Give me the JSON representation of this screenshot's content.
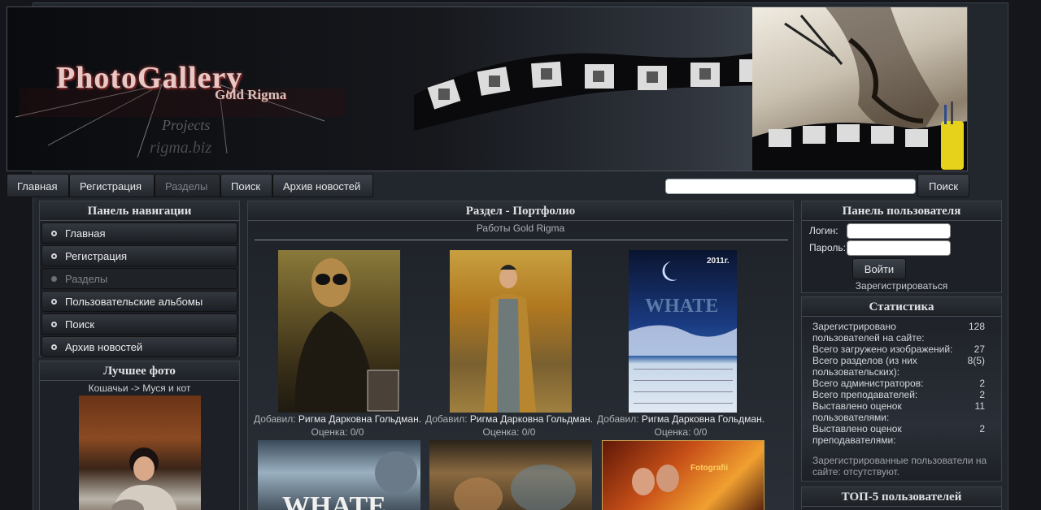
{
  "banner": {
    "logo_title": "PhotoGallery",
    "logo_subtitle": "Gold Rigma",
    "logo_projects": "Projects",
    "logo_url": "rigma.biz"
  },
  "nav": {
    "items": [
      "Главная",
      "Регистрация",
      "Разделы",
      "Поиск",
      "Архив новостей"
    ],
    "search_value": "",
    "search_button": "Поиск"
  },
  "left_nav": {
    "title": "Панель навигации",
    "items": [
      "Главная",
      "Регистрация",
      "Разделы",
      "Пользовательские альбомы",
      "Поиск",
      "Архив новостей"
    ]
  },
  "best_photo": {
    "title": "Лучшее фото",
    "caption": "Кошачьи -> Муся и кот"
  },
  "center": {
    "title": "Раздел - Портфолио",
    "subtitle": "Работы Gold Rigma",
    "added_label": "Добавил:",
    "thumbs": [
      {
        "author": "Ригма Дарковна Гольдман.",
        "rating": "Оценка: 0/0"
      },
      {
        "author": "Ригма Дарковна Гольдман.",
        "rating": "Оценка: 0/0"
      },
      {
        "author": "Ригма Дарковна Гольдман.",
        "rating": "Оценка: 0/0",
        "year_text": "2011г.",
        "title_text": "WHATE"
      }
    ],
    "second_row_text": [
      "WHATE",
      "Fotografii"
    ]
  },
  "user_panel": {
    "title": "Панель пользователя",
    "login_label": "Логин:",
    "password_label": "Пароль:",
    "login_value": "",
    "password_value": "",
    "enter_button": "Войти",
    "register_link": "Зарегистрироваться"
  },
  "stats": {
    "title": "Статистика",
    "rows": [
      {
        "label": "Зарегистрировано пользователей на сайте:",
        "value": "128"
      },
      {
        "label": "Всего загружено изображений:",
        "value": "27"
      },
      {
        "label": "Всего разделов (из них пользовательских):",
        "value": "8(5)"
      },
      {
        "label": "Всего администраторов:",
        "value": "2"
      },
      {
        "label": "Всего преподавателей:",
        "value": "2"
      },
      {
        "label": "Выставлено оценок пользователями:",
        "value": "11"
      },
      {
        "label": "Выставлено оценок преподавателями:",
        "value": "2"
      }
    ],
    "online": "Зарегистрированные пользователи на сайте: отсутствуют."
  },
  "top5": {
    "title": "ТОП-5 пользователей"
  },
  "colors": {
    "page_bg": "#14161b",
    "panel_bg": "#1d2026",
    "accent_text": "#e6e8ea"
  }
}
